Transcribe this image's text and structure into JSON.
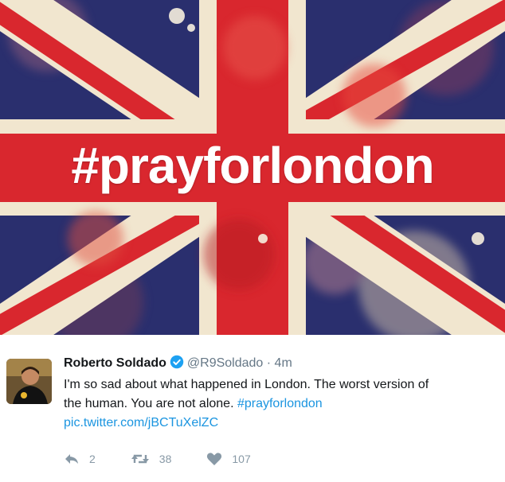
{
  "image": {
    "overlay_text": "#prayforlondon",
    "colors": {
      "red": "#d9272e",
      "blue": "#2a2f6e",
      "cream": "#f3ead7"
    }
  },
  "tweet": {
    "display_name": "Roberto Soldado",
    "handle": "@R9Soldado",
    "separator": "·",
    "time": "4m",
    "text_line_1": "I'm so sad about what happened in London. The worst version of",
    "text_line_2_prefix": "the human. You are not alone. ",
    "hashtag": "#prayforlondon",
    "link": "pic.twitter.com/jBCTuXelZC",
    "actions": {
      "reply_count": "2",
      "retweet_count": "38",
      "like_count": "107"
    }
  },
  "icons": [
    "verified-icon",
    "reply-icon",
    "retweet-icon",
    "heart-icon"
  ]
}
